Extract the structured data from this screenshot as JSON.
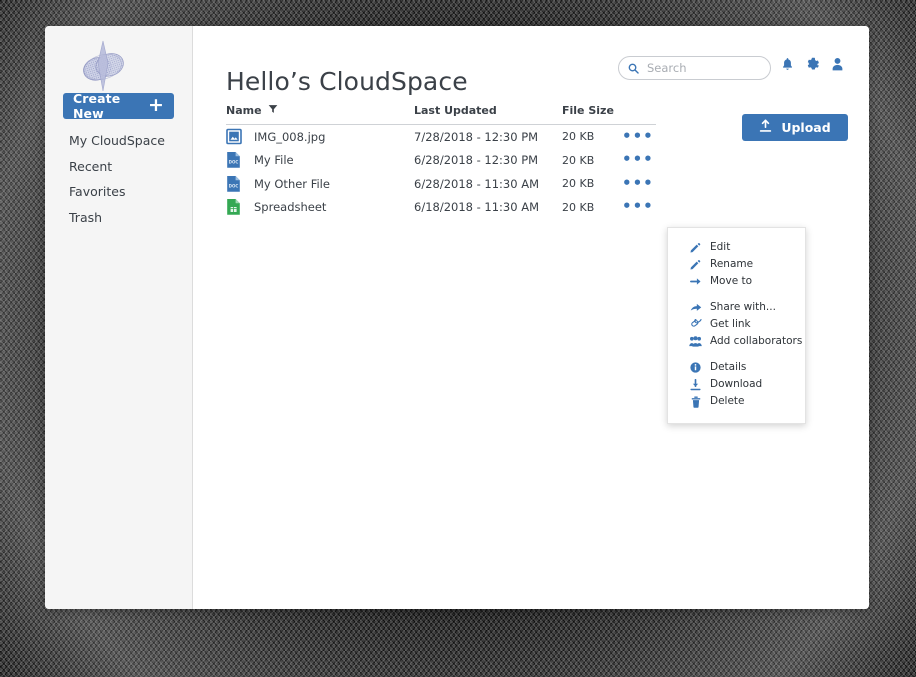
{
  "window": {
    "brand_logo": "cloudspace-logo"
  },
  "colors": {
    "accent": "#3b75b5",
    "text": "#3b4148",
    "sidebar_bg": "#f5f5f5",
    "muted": "#a9adb3",
    "doc_blue": "#3b75b5",
    "sheet_green": "#34a853"
  },
  "sidebar": {
    "create_button": {
      "label": "Create New",
      "plus": "+"
    },
    "items": [
      {
        "label": "My CloudSpace",
        "name": "sidebar-item-my-cloudspace"
      },
      {
        "label": "Recent",
        "name": "sidebar-item-recent"
      },
      {
        "label": "Favorites",
        "name": "sidebar-item-favorites"
      },
      {
        "label": "Trash",
        "name": "sidebar-item-trash"
      }
    ]
  },
  "header": {
    "title": "Hello’s CloudSpace",
    "search": {
      "placeholder": "Search",
      "value": "",
      "icon": "search-icon"
    },
    "icons": [
      {
        "name": "notifications-bell-icon",
        "label": "Notifications"
      },
      {
        "name": "settings-gear-icon",
        "label": "Settings"
      },
      {
        "name": "user-account-icon",
        "label": "Account"
      }
    ]
  },
  "actions": {
    "upload_label": "Upload",
    "upload_icon": "upload-icon"
  },
  "file_table": {
    "columns": [
      {
        "key": "name",
        "label": "Name",
        "sort_icon": "filter-funnel-icon"
      },
      {
        "key": "updated",
        "label": "Last Updated"
      },
      {
        "key": "size",
        "label": "File Size"
      }
    ],
    "rows": [
      {
        "icon": "image-file-icon",
        "name": "IMG_008.jpg",
        "updated": "7/28/2018 - 12:30 PM",
        "size": "20 KB",
        "menu": "•••"
      },
      {
        "icon": "doc-file-icon",
        "name": "My File",
        "updated": "6/28/2018 - 12:30 PM",
        "size": "20 KB",
        "menu": "•••"
      },
      {
        "icon": "doc-file-icon",
        "name": "My Other File",
        "updated": "6/28/2018 - 11:30 AM",
        "size": "20 KB",
        "menu": "•••"
      },
      {
        "icon": "sheet-file-icon",
        "name": "Spreadsheet",
        "updated": "6/18/2018 - 11:30 AM",
        "size": "20 KB",
        "menu": "•••"
      }
    ]
  },
  "context_menu": {
    "groups": [
      {
        "items": [
          {
            "label": "Edit",
            "icon": "pencil-icon"
          },
          {
            "label": "Rename",
            "icon": "pencil-icon"
          },
          {
            "label": "Move to",
            "icon": "arrow-right-icon"
          }
        ]
      },
      {
        "items": [
          {
            "label": "Share with...",
            "icon": "share-arrow-icon"
          },
          {
            "label": "Get link",
            "icon": "link-chain-icon"
          },
          {
            "label": "Add collaborators",
            "icon": "people-group-icon"
          }
        ]
      },
      {
        "items": [
          {
            "label": "Details",
            "icon": "info-circle-icon"
          },
          {
            "label": "Download",
            "icon": "download-icon"
          },
          {
            "label": "Delete",
            "icon": "trash-icon"
          }
        ]
      }
    ]
  }
}
